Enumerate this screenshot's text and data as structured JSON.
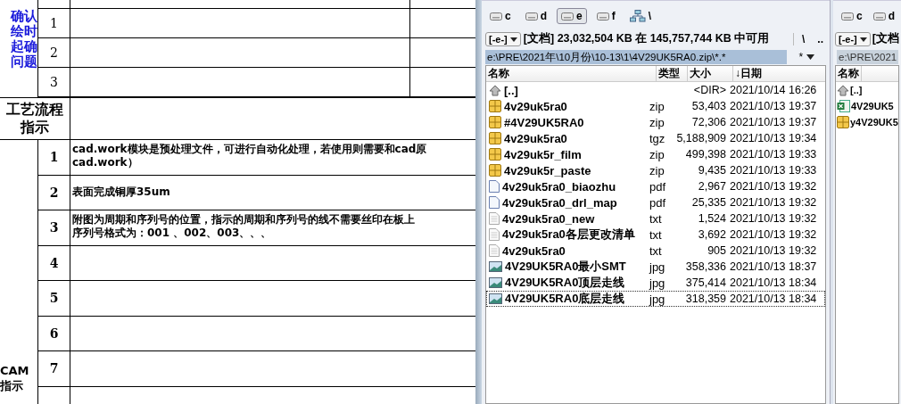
{
  "sheet": {
    "confirm_section": {
      "label_lines": [
        "确认",
        "绘时",
        "起确",
        "问题"
      ],
      "rows": [
        {
          "number": "1"
        },
        {
          "number": "2"
        },
        {
          "number": "3"
        }
      ]
    },
    "process_section": {
      "label_lines": [
        "工艺流程",
        "指示"
      ]
    },
    "cam_section": {
      "label_lines": [
        "CAM",
        "指示"
      ],
      "rows": [
        {
          "number": "1",
          "lines": [
            "cad.work模块是预处理文件，可进行自动化处理，若使用则需要和cad原",
            "cad.work）"
          ]
        },
        {
          "number": "2",
          "lines": [
            "表面完成铜厚35um"
          ]
        },
        {
          "number": "3",
          "lines": [
            "附图为周期和序列号的位置，指示的周期和序列号的线不需要丝印在板上",
            "序列号格式为：001 、002、003、、、"
          ]
        },
        {
          "number": "4"
        },
        {
          "number": "5"
        },
        {
          "number": "6"
        },
        {
          "number": "7"
        }
      ]
    }
  },
  "left_panel": {
    "drives": [
      {
        "label": "c",
        "kind": "disk",
        "selected": false
      },
      {
        "label": "d",
        "kind": "disk",
        "selected": false
      },
      {
        "label": "e",
        "kind": "disk",
        "selected": true
      },
      {
        "label": "f",
        "kind": "disk",
        "selected": false
      },
      {
        "label": "\\",
        "kind": "network",
        "selected": false
      }
    ],
    "drive_select": "[-e-]",
    "volume_info": "[文档]  23,032,504 KB 在 145,757,744 KB 中可用",
    "nav_buttons": [
      "\\",
      ".."
    ],
    "path": "e:\\PRE\\2021年\\10月份\\10-13\\1\\4V29UK5RA0.zip\\*.*",
    "filter": "*",
    "columns": [
      "名称",
      "类型",
      "大小",
      "↓日期"
    ],
    "files": [
      {
        "name": "[..]",
        "kind": "up",
        "size": "<DIR>",
        "date": "2021/10/14 16:26",
        "focused": false
      },
      {
        "name": "4v29uk5ra0",
        "kind": "archive",
        "type": "zip",
        "size": "53,403",
        "date": "2021/10/13 19:37",
        "focused": false
      },
      {
        "name": "#4V29UK5RA0",
        "kind": "archive",
        "type": "zip",
        "size": "72,306",
        "date": "2021/10/13 19:37",
        "focused": false
      },
      {
        "name": "4v29uk5ra0",
        "kind": "archive",
        "type": "tgz",
        "size": "5,188,909",
        "date": "2021/10/13 19:34",
        "focused": false
      },
      {
        "name": "4v29uk5r_film",
        "kind": "archive",
        "type": "zip",
        "size": "499,398",
        "date": "2021/10/13 19:33",
        "focused": false
      },
      {
        "name": "4v29uk5r_paste",
        "kind": "archive",
        "type": "zip",
        "size": "9,435",
        "date": "2021/10/13 19:33",
        "focused": false
      },
      {
        "name": "4v29uk5ra0_biaozhu",
        "kind": "doc",
        "type": "pdf",
        "size": "2,967",
        "date": "2021/10/13 19:32",
        "focused": false
      },
      {
        "name": "4v29uk5ra0_drl_map",
        "kind": "doc",
        "type": "pdf",
        "size": "25,335",
        "date": "2021/10/13 19:32",
        "focused": false
      },
      {
        "name": "4v29uk5ra0_new",
        "kind": "text",
        "type": "txt",
        "size": "1,524",
        "date": "2021/10/13 19:32",
        "focused": false
      },
      {
        "name": "4v29uk5ra0各层更改清单",
        "kind": "text",
        "type": "txt",
        "size": "3,692",
        "date": "2021/10/13 19:32",
        "focused": false
      },
      {
        "name": "4v29uk5ra0",
        "kind": "text",
        "type": "txt",
        "size": "905",
        "date": "2021/10/13 19:32",
        "focused": false
      },
      {
        "name": "4V29UK5RA0最小SMT",
        "kind": "image",
        "type": "jpg",
        "size": "358,336",
        "date": "2021/10/13 18:37",
        "focused": false
      },
      {
        "name": "4V29UK5RA0顶层走线",
        "kind": "image",
        "type": "jpg",
        "size": "375,414",
        "date": "2021/10/13 18:34",
        "focused": false
      },
      {
        "name": "4V29UK5RA0底层走线",
        "kind": "image",
        "type": "jpg",
        "size": "318,359",
        "date": "2021/10/13 18:34",
        "focused": true
      }
    ]
  },
  "right_panel": {
    "drives": [
      {
        "label": "c",
        "kind": "disk",
        "selected": false
      },
      {
        "label": "d",
        "kind": "disk",
        "selected": false
      }
    ],
    "drive_select": "[-e-]",
    "volume_info": "[文档",
    "path": "e:\\PRE\\2021",
    "columns": [
      "名称"
    ],
    "files": [
      {
        "name": "[..]",
        "kind": "up"
      },
      {
        "name": "4V29UK5",
        "kind": "sheet"
      },
      {
        "name": "y4V29UK5",
        "kind": "archive"
      }
    ]
  }
}
